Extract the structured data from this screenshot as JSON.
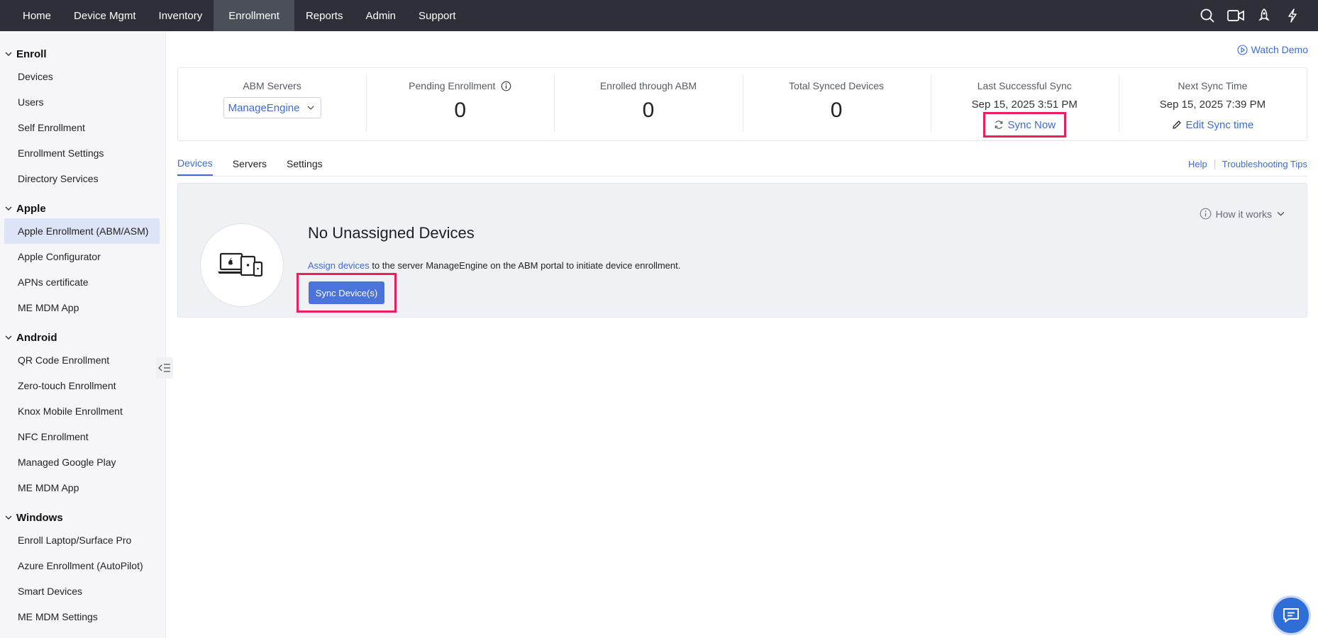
{
  "topnav": {
    "items": [
      {
        "label": "Home"
      },
      {
        "label": "Device Mgmt"
      },
      {
        "label": "Inventory"
      },
      {
        "label": "Enrollment"
      },
      {
        "label": "Reports"
      },
      {
        "label": "Admin"
      },
      {
        "label": "Support"
      }
    ],
    "active": "Enrollment",
    "right_icons": [
      "search-icon",
      "video-icon",
      "rocket-icon",
      "lightning-icon"
    ]
  },
  "sidebar": {
    "groups": [
      {
        "title": "Enroll",
        "items": [
          "Devices",
          "Users",
          "Self Enrollment",
          "Enrollment Settings",
          "Directory Services"
        ]
      },
      {
        "title": "Apple",
        "items": [
          "Apple Enrollment (ABM/ASM)",
          "Apple Configurator",
          "APNs certificate",
          "ME MDM App"
        ]
      },
      {
        "title": "Android",
        "items": [
          "QR Code Enrollment",
          "Zero-touch Enrollment",
          "Knox Mobile Enrollment",
          "NFC Enrollment",
          "Managed Google Play",
          "ME MDM App"
        ]
      },
      {
        "title": "Windows",
        "items": [
          "Enroll Laptop/Surface Pro",
          "Azure Enrollment (AutoPilot)",
          "Smart Devices",
          "ME MDM Settings"
        ]
      }
    ],
    "active_item": "Apple Enrollment (ABM/ASM)"
  },
  "header": {
    "watch_demo": "Watch Demo"
  },
  "stats": {
    "abm_servers": {
      "label": "ABM Servers",
      "selected": "ManageEngine"
    },
    "pending_enrollment": {
      "label": "Pending Enrollment",
      "value": "0"
    },
    "enrolled_abm": {
      "label": "Enrolled through ABM",
      "value": "0"
    },
    "total_synced": {
      "label": "Total Synced Devices",
      "value": "0"
    },
    "last_sync": {
      "label": "Last Successful Sync",
      "value": "Sep 15, 2025 3:51 PM",
      "action": "Sync Now"
    },
    "next_sync": {
      "label": "Next Sync Time",
      "value": "Sep 15, 2025 7:39 PM",
      "action": "Edit Sync time"
    }
  },
  "tabs": {
    "items": [
      "Devices",
      "Servers",
      "Settings"
    ],
    "active": "Devices",
    "help": "Help",
    "troubleshooting": "Troubleshooting Tips"
  },
  "panel": {
    "title": "No Unassigned Devices",
    "desc_link": "Assign devices",
    "desc_text": " to the server ManageEngine on the ABM portal to initiate device enrollment.",
    "button": "Sync Device(s)",
    "how_it_works": "How it works"
  },
  "colors": {
    "accent": "#3d6bd4",
    "highlight": "#ea1f5c",
    "nav_bg": "#2d3039"
  }
}
